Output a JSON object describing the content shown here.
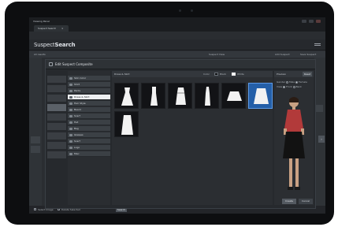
{
  "window": {
    "title": "Viewing Panel"
  },
  "tab": {
    "label": "Suspect Search",
    "close": "×"
  },
  "app": {
    "logo_light": "Suspect",
    "logo_bold": "Search"
  },
  "subbar": {
    "left_label": "All results",
    "mid_label": "Suspect View",
    "right_btn1": "Add Suspect",
    "right_btn2": "Save Suspect"
  },
  "dialog": {
    "title": "Edit Suspect Composite",
    "categories": [
      {
        "label": "Skin Color"
      },
      {
        "label": "Shirt"
      },
      {
        "label": "Pants"
      },
      {
        "label": "Dress & Skirt"
      },
      {
        "label": "Hair Style"
      },
      {
        "label": "Beard"
      },
      {
        "label": "Scarf"
      },
      {
        "label": "Hat"
      },
      {
        "label": "Bag"
      },
      {
        "label": "Glasses"
      },
      {
        "label": "Scarf"
      },
      {
        "label": "Logo"
      },
      {
        "label": "Misc"
      }
    ],
    "selected_category_index": 3,
    "grid": {
      "heading": "Dress & Skirt",
      "color_label": "Color",
      "color_option1": "Black",
      "color_option2": "White",
      "selected_item_index": 5,
      "items": [
        {
          "kind": "dress-a"
        },
        {
          "kind": "dress-b"
        },
        {
          "kind": "dress-c"
        },
        {
          "kind": "dress-d"
        },
        {
          "kind": "skirt-short"
        },
        {
          "kind": "skirt-flare"
        },
        {
          "kind": "skirt-long"
        }
      ]
    },
    "preview": {
      "heading": "Preview",
      "reset_btn": "Reset",
      "gender_label": "Gender",
      "gender_male": "Male",
      "gender_female": "Female",
      "view_label": "View",
      "view_front": "Front",
      "view_back": "Back"
    },
    "ok_btn": "Create",
    "cancel_btn": "Cancel"
  },
  "footer": {
    "check1_label": "Select Image",
    "check2_label": "Delete Selected",
    "btn_label": "Search"
  },
  "colors": {
    "accent": "#245fa8",
    "shirt": "#b23a3a",
    "skirt": "#121212",
    "skin": "#c9a183"
  }
}
